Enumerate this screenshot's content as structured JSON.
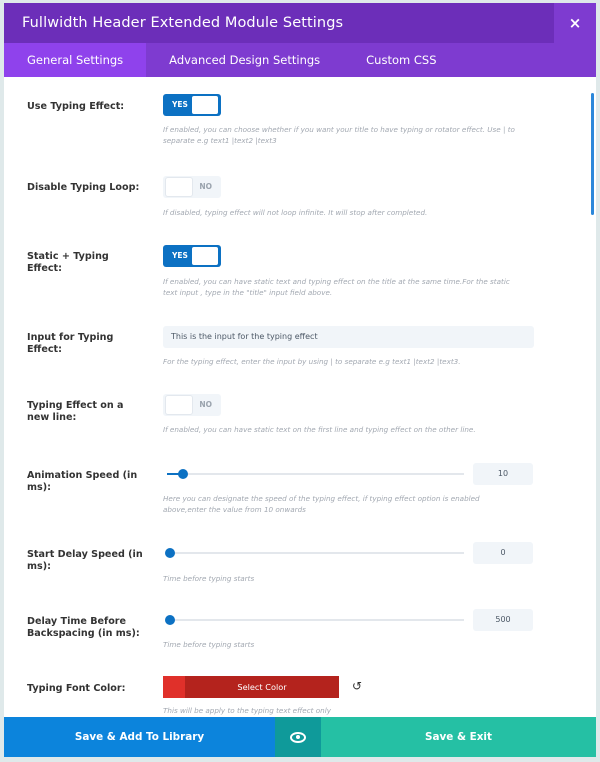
{
  "modal": {
    "title": "Fullwidth Header Extended Module Settings",
    "close": "×"
  },
  "tabs": [
    {
      "label": "General Settings",
      "active": true
    },
    {
      "label": "Advanced Design Settings",
      "active": false
    },
    {
      "label": "Custom CSS",
      "active": false
    }
  ],
  "settings": {
    "typing_effect": {
      "label": "Use Typing Effect:",
      "value": "YES",
      "desc": "If enabled, you can choose whether if you want your title to have typing or rotator effect. Use | to separate e.g text1 |text2 |text3"
    },
    "disable_loop": {
      "label": "Disable Typing Loop:",
      "value": "NO",
      "desc": "If disabled, typing effect will not loop infinite. It will stop after completed."
    },
    "static_typing": {
      "label": "Static + Typing Effect:",
      "value": "YES",
      "desc": "If enabled, you can have static text and typing effect on the title at the same time.For the static text input , type in the \"title\" input field above."
    },
    "input_typing": {
      "label": "Input for Typing Effect:",
      "value": "This is the input for the typing effect",
      "desc": "For the typing effect, enter the input by using | to separate e.g text1 |text2 |text3."
    },
    "new_line": {
      "label": "Typing Effect on a new line:",
      "value": "NO",
      "desc": "If enabled, you can have static text on the first line and typing effect on the other line."
    },
    "animation_speed": {
      "label": "Animation Speed (in ms):",
      "value": "10",
      "desc": "Here you can designate the speed of the typing effect, if typing effect option is enabled above,enter the value from 10 onwards"
    },
    "start_delay": {
      "label": "Start Delay Speed (in ms):",
      "value": "0",
      "desc": "Time before typing starts"
    },
    "delay_backspace": {
      "label": "Delay Time Before Backspacing (in ms):",
      "value": "500",
      "desc": "Time before typing starts"
    },
    "font_color": {
      "label": "Typing Font Color:",
      "button": "Select Color",
      "desc": "This will be apply to the typing text effect only",
      "color": "#e0302a"
    }
  },
  "footer": {
    "save_library": "Save & Add To Library",
    "save_exit": "Save & Exit"
  },
  "colors": {
    "purple_header": "#6c2eb9",
    "purple_tabs": "#7e3bd0",
    "blue": "#0c71c3",
    "teal": "#25c0a4"
  }
}
